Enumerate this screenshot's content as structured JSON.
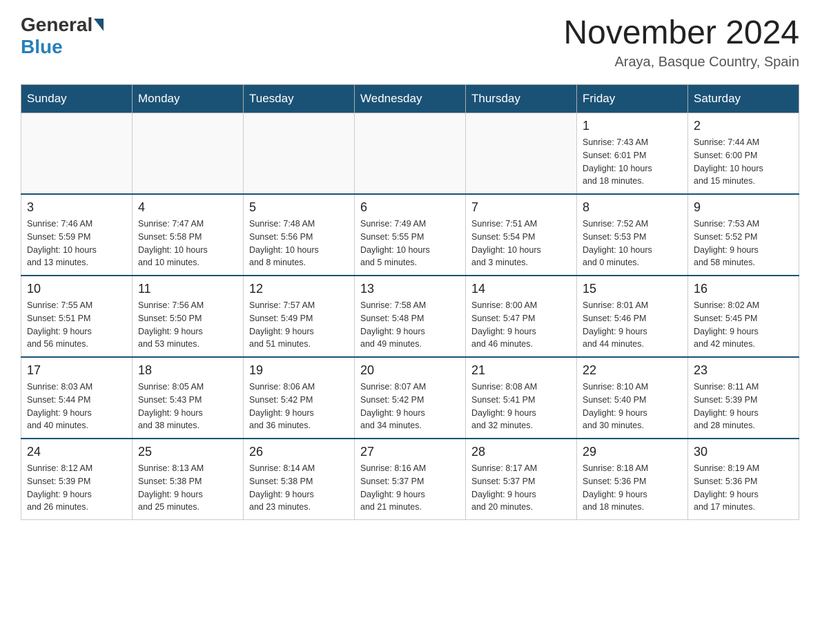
{
  "header": {
    "logo_general": "General",
    "logo_blue": "Blue",
    "title": "November 2024",
    "subtitle": "Araya, Basque Country, Spain"
  },
  "weekdays": [
    "Sunday",
    "Monday",
    "Tuesday",
    "Wednesday",
    "Thursday",
    "Friday",
    "Saturday"
  ],
  "weeks": [
    [
      {
        "day": "",
        "info": ""
      },
      {
        "day": "",
        "info": ""
      },
      {
        "day": "",
        "info": ""
      },
      {
        "day": "",
        "info": ""
      },
      {
        "day": "",
        "info": ""
      },
      {
        "day": "1",
        "info": "Sunrise: 7:43 AM\nSunset: 6:01 PM\nDaylight: 10 hours\nand 18 minutes."
      },
      {
        "day": "2",
        "info": "Sunrise: 7:44 AM\nSunset: 6:00 PM\nDaylight: 10 hours\nand 15 minutes."
      }
    ],
    [
      {
        "day": "3",
        "info": "Sunrise: 7:46 AM\nSunset: 5:59 PM\nDaylight: 10 hours\nand 13 minutes."
      },
      {
        "day": "4",
        "info": "Sunrise: 7:47 AM\nSunset: 5:58 PM\nDaylight: 10 hours\nand 10 minutes."
      },
      {
        "day": "5",
        "info": "Sunrise: 7:48 AM\nSunset: 5:56 PM\nDaylight: 10 hours\nand 8 minutes."
      },
      {
        "day": "6",
        "info": "Sunrise: 7:49 AM\nSunset: 5:55 PM\nDaylight: 10 hours\nand 5 minutes."
      },
      {
        "day": "7",
        "info": "Sunrise: 7:51 AM\nSunset: 5:54 PM\nDaylight: 10 hours\nand 3 minutes."
      },
      {
        "day": "8",
        "info": "Sunrise: 7:52 AM\nSunset: 5:53 PM\nDaylight: 10 hours\nand 0 minutes."
      },
      {
        "day": "9",
        "info": "Sunrise: 7:53 AM\nSunset: 5:52 PM\nDaylight: 9 hours\nand 58 minutes."
      }
    ],
    [
      {
        "day": "10",
        "info": "Sunrise: 7:55 AM\nSunset: 5:51 PM\nDaylight: 9 hours\nand 56 minutes."
      },
      {
        "day": "11",
        "info": "Sunrise: 7:56 AM\nSunset: 5:50 PM\nDaylight: 9 hours\nand 53 minutes."
      },
      {
        "day": "12",
        "info": "Sunrise: 7:57 AM\nSunset: 5:49 PM\nDaylight: 9 hours\nand 51 minutes."
      },
      {
        "day": "13",
        "info": "Sunrise: 7:58 AM\nSunset: 5:48 PM\nDaylight: 9 hours\nand 49 minutes."
      },
      {
        "day": "14",
        "info": "Sunrise: 8:00 AM\nSunset: 5:47 PM\nDaylight: 9 hours\nand 46 minutes."
      },
      {
        "day": "15",
        "info": "Sunrise: 8:01 AM\nSunset: 5:46 PM\nDaylight: 9 hours\nand 44 minutes."
      },
      {
        "day": "16",
        "info": "Sunrise: 8:02 AM\nSunset: 5:45 PM\nDaylight: 9 hours\nand 42 minutes."
      }
    ],
    [
      {
        "day": "17",
        "info": "Sunrise: 8:03 AM\nSunset: 5:44 PM\nDaylight: 9 hours\nand 40 minutes."
      },
      {
        "day": "18",
        "info": "Sunrise: 8:05 AM\nSunset: 5:43 PM\nDaylight: 9 hours\nand 38 minutes."
      },
      {
        "day": "19",
        "info": "Sunrise: 8:06 AM\nSunset: 5:42 PM\nDaylight: 9 hours\nand 36 minutes."
      },
      {
        "day": "20",
        "info": "Sunrise: 8:07 AM\nSunset: 5:42 PM\nDaylight: 9 hours\nand 34 minutes."
      },
      {
        "day": "21",
        "info": "Sunrise: 8:08 AM\nSunset: 5:41 PM\nDaylight: 9 hours\nand 32 minutes."
      },
      {
        "day": "22",
        "info": "Sunrise: 8:10 AM\nSunset: 5:40 PM\nDaylight: 9 hours\nand 30 minutes."
      },
      {
        "day": "23",
        "info": "Sunrise: 8:11 AM\nSunset: 5:39 PM\nDaylight: 9 hours\nand 28 minutes."
      }
    ],
    [
      {
        "day": "24",
        "info": "Sunrise: 8:12 AM\nSunset: 5:39 PM\nDaylight: 9 hours\nand 26 minutes."
      },
      {
        "day": "25",
        "info": "Sunrise: 8:13 AM\nSunset: 5:38 PM\nDaylight: 9 hours\nand 25 minutes."
      },
      {
        "day": "26",
        "info": "Sunrise: 8:14 AM\nSunset: 5:38 PM\nDaylight: 9 hours\nand 23 minutes."
      },
      {
        "day": "27",
        "info": "Sunrise: 8:16 AM\nSunset: 5:37 PM\nDaylight: 9 hours\nand 21 minutes."
      },
      {
        "day": "28",
        "info": "Sunrise: 8:17 AM\nSunset: 5:37 PM\nDaylight: 9 hours\nand 20 minutes."
      },
      {
        "day": "29",
        "info": "Sunrise: 8:18 AM\nSunset: 5:36 PM\nDaylight: 9 hours\nand 18 minutes."
      },
      {
        "day": "30",
        "info": "Sunrise: 8:19 AM\nSunset: 5:36 PM\nDaylight: 9 hours\nand 17 minutes."
      }
    ]
  ]
}
